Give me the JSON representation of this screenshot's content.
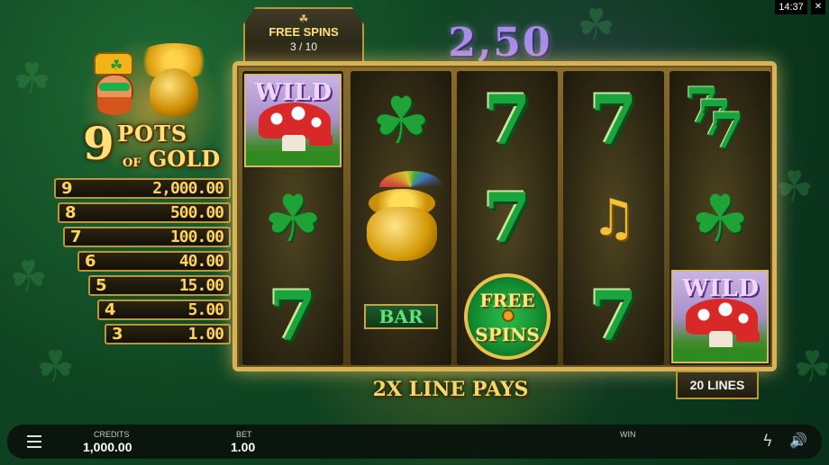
{
  "status": {
    "clock": "14:37"
  },
  "logo": {
    "number": "9",
    "line1": "POTS",
    "of": "OF",
    "line2": "GOLD"
  },
  "paytable": [
    {
      "pots": "9",
      "amount": "2,000.00"
    },
    {
      "pots": "8",
      "amount": "500.00"
    },
    {
      "pots": "7",
      "amount": "100.00"
    },
    {
      "pots": "6",
      "amount": "40.00"
    },
    {
      "pots": "5",
      "amount": "15.00"
    },
    {
      "pots": "4",
      "amount": "5.00"
    },
    {
      "pots": "3",
      "amount": "1.00"
    }
  ],
  "free_spins": {
    "title": "FREE SPINS",
    "count": "3 / 10"
  },
  "win_display": "2,50",
  "reels": [
    [
      "wild",
      "clover",
      "seven"
    ],
    [
      "clover",
      "pot-of-gold",
      "bar"
    ],
    [
      "seven",
      "seven",
      "free-spins"
    ],
    [
      "seven",
      "lyre",
      "seven"
    ],
    [
      "triple-seven",
      "clover",
      "wild"
    ]
  ],
  "symbols": {
    "wild_text": "WILD",
    "bar_text": "BAR",
    "free_text_1": "FREE",
    "free_text_2": "SPINS",
    "seven_glyph": "7",
    "clover_glyph": "☘",
    "lyre_glyph": "♫"
  },
  "line_pays": "2X LINE PAYS",
  "lines": "20 LINES",
  "bottom_bar": {
    "credits_label": "CREDITS",
    "credits_value": "1,000.00",
    "bet_label": "BET",
    "bet_value": "1.00",
    "win_label": "WIN",
    "win_value": ""
  },
  "icons": {
    "menu": "hamburger-icon",
    "turbo": "lightning-icon",
    "sound": "speaker-icon"
  },
  "colors": {
    "accent_gold": "#d7b257",
    "seven_green": "#1aa43c",
    "win_purple": "#a78de8"
  }
}
